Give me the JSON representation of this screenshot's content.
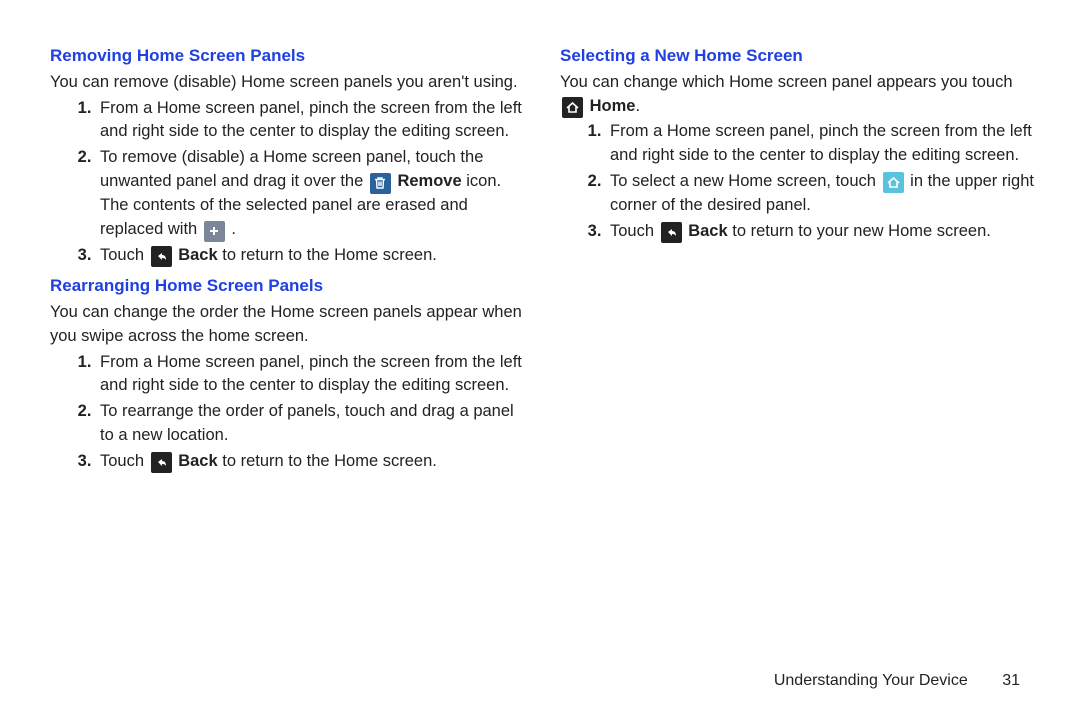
{
  "left": {
    "sec1": {
      "heading": "Removing Home Screen Panels",
      "intro": "You can remove (disable) Home screen panels you aren't using.",
      "step1": "From a Home screen panel, pinch the screen from the left and right side to the center to display the editing screen.",
      "step2a": "To remove (disable) a Home screen panel, touch the unwanted panel and drag it over the ",
      "step2b_label": " Remove",
      "step2c": " icon. The contents of the selected panel are erased and replaced with ",
      "step2d": " .",
      "step3a": "Touch ",
      "step3b_label": " Back",
      "step3c": " to return to the Home screen."
    },
    "sec2": {
      "heading": "Rearranging Home Screen Panels",
      "intro": "You can change the order the Home screen panels appear when you swipe across the home screen.",
      "step1": "From a Home screen panel, pinch the screen from the left and right side to the center to display the editing screen.",
      "step2": "To rearrange the order of panels, touch and drag a panel to a new location.",
      "step3a": "Touch ",
      "step3b_label": " Back",
      "step3c": " to return to the Home screen."
    }
  },
  "right": {
    "sec1": {
      "heading": "Selecting a New Home Screen",
      "intro_a": "You can change which Home screen panel appears you touch ",
      "intro_b_label": " Home",
      "intro_c": ".",
      "step1": "From a Home screen panel, pinch the screen from the left and right side to the center to display the editing screen.",
      "step2a": "To select a new Home screen, touch ",
      "step2b": " in the upper right corner of the desired panel.",
      "step3a": "Touch ",
      "step3b_label": " Back",
      "step3c": " to return to your new Home screen."
    }
  },
  "footer": {
    "label": "Understanding Your Device",
    "page": "31"
  }
}
